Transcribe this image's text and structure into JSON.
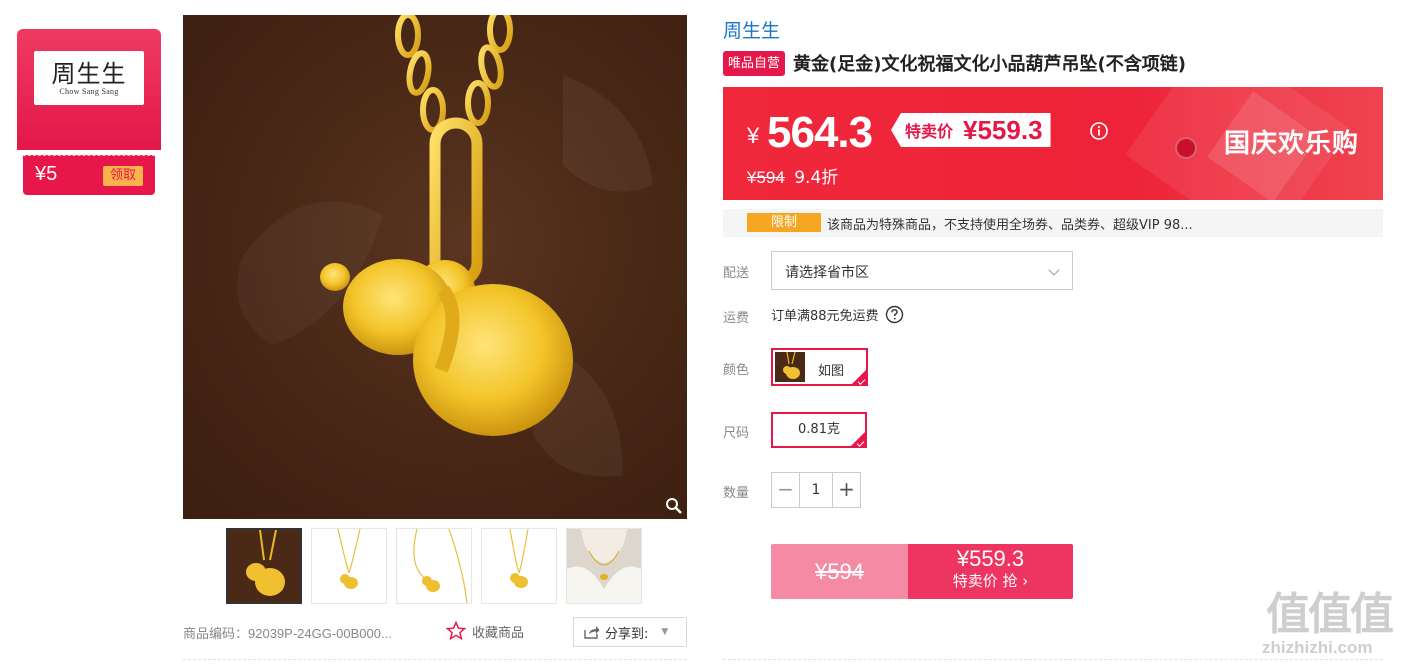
{
  "coupon": {
    "brand_cn": "周生生",
    "brand_en": "Chow Sang Sang",
    "value": "¥5",
    "claim_label": "领取"
  },
  "gallery": {
    "thumbnails": [
      "pendant-on-brown",
      "pendant-chain-1",
      "pendant-chain-2",
      "pendant-chain-3",
      "model-wearing"
    ]
  },
  "meta": {
    "sku": "商品编码：92039P-24GG-00B000...",
    "favorite_label": "收藏商品",
    "share_label": "分享到:"
  },
  "product": {
    "brand": "周生生",
    "badge": "唯品自营",
    "title": "黄金(足金)文化祝福文化小品葫芦吊坠(不含项链)"
  },
  "price": {
    "currency": "¥",
    "current": "564.3",
    "special_label": "特卖价",
    "special_price": "¥559.3",
    "original": "¥594",
    "discount": "9.4折",
    "festival": "国庆欢乐购"
  },
  "limit": {
    "tag": "限制",
    "text": "该商品为特殊商品，不支持使用全场券、品类券、超级VIP 98..."
  },
  "delivery": {
    "label": "配送",
    "placeholder": "请选择省市区"
  },
  "shipping": {
    "label": "运费",
    "text": "订单满88元免运费"
  },
  "color": {
    "label": "颜色",
    "option": "如图"
  },
  "size": {
    "label": "尺码",
    "option": "0.81克"
  },
  "quantity": {
    "label": "数量",
    "value": "1",
    "minus": "−",
    "plus": "+"
  },
  "buy": {
    "original": "¥594",
    "price": "¥559.3",
    "action": "特卖价 抢 ›"
  },
  "watermark": {
    "glyphs": "值值值",
    "url": "zhizhizhi.com"
  },
  "colors": {
    "accent": "#e4184a",
    "price_bg": "#f0283b",
    "brand_link": "#1a76c9",
    "limit_tag": "#f5a623"
  }
}
